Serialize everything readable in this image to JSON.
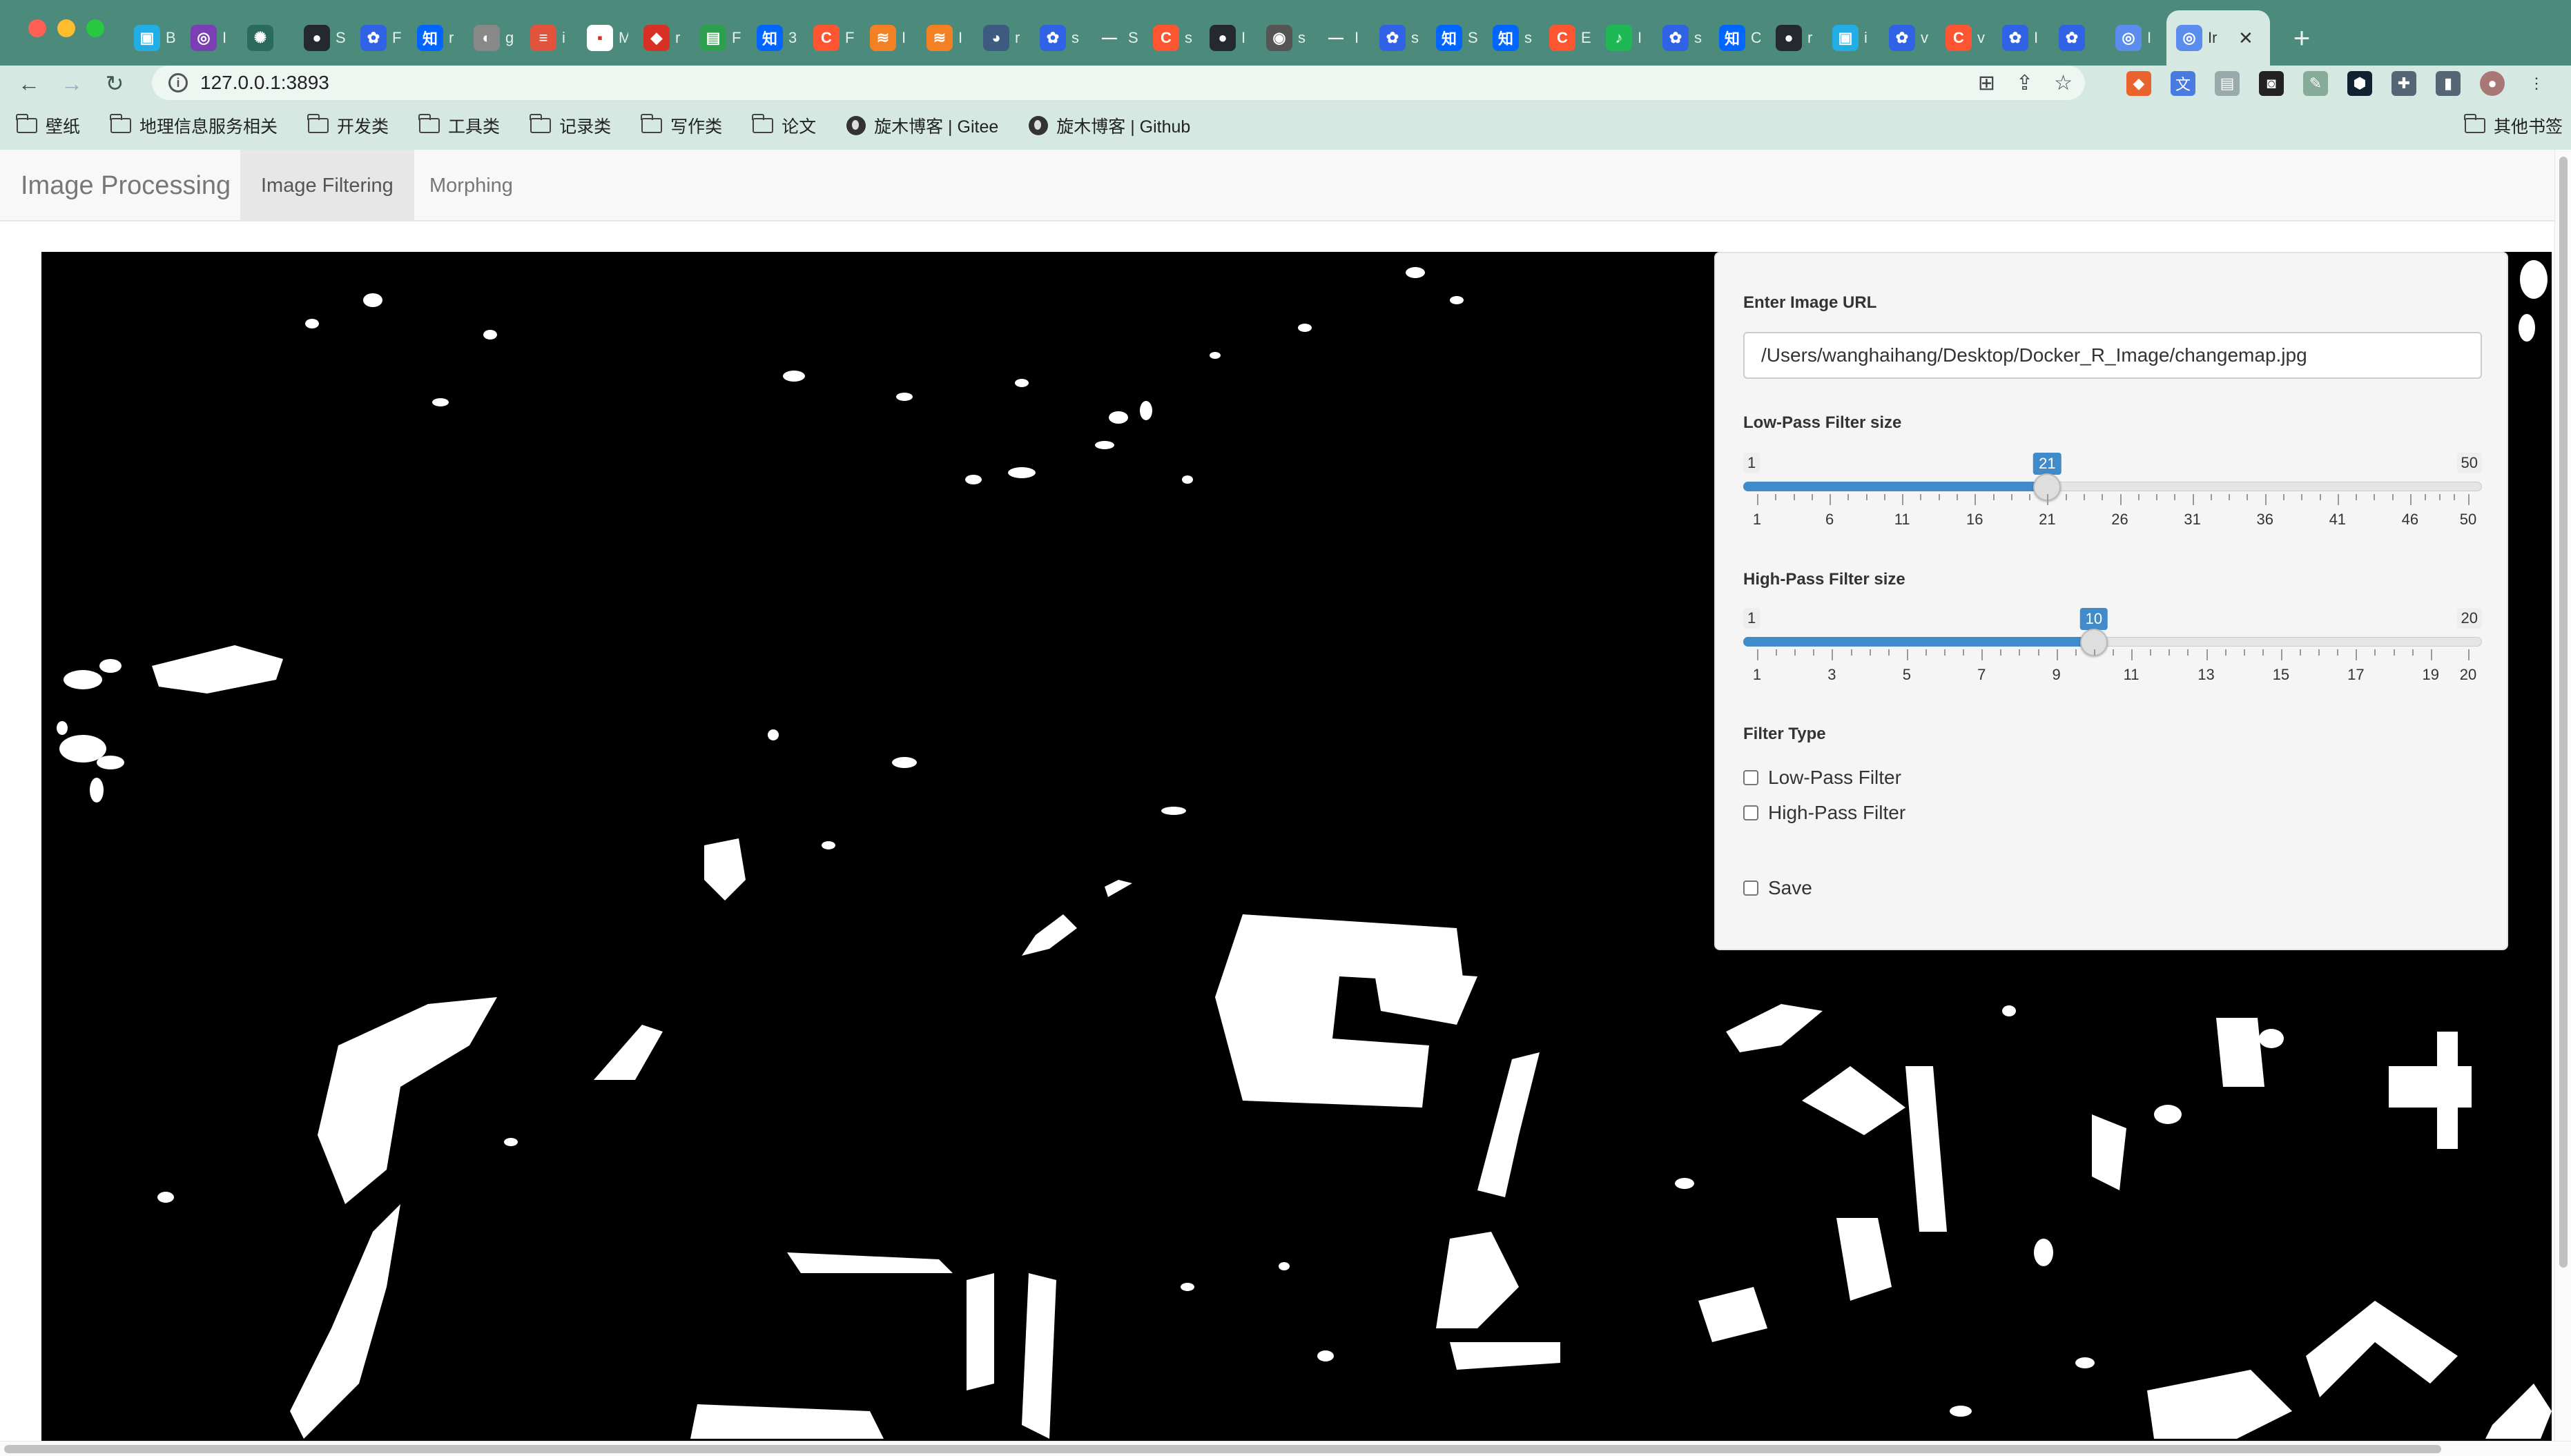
{
  "browser": {
    "url": "127.0.0.1:3893",
    "tabs": [
      {
        "icon": "bilibili-icon",
        "color": "#23ade5",
        "glyph": "▣",
        "label": "B"
      },
      {
        "icon": "app-icon",
        "color": "#7a3fb3",
        "glyph": "◎",
        "label": "I"
      },
      {
        "icon": "openai-icon",
        "color": "#2b6b5f",
        "glyph": "✺",
        "label": ""
      },
      {
        "icon": "github-icon",
        "color": "#24292f",
        "glyph": "●",
        "label": "S"
      },
      {
        "icon": "baidu-icon",
        "color": "#2f62e5",
        "glyph": "✿",
        "label": "F"
      },
      {
        "icon": "zhihu-icon",
        "color": "#0066ff",
        "glyph": "知",
        "label": "r"
      },
      {
        "icon": "generic-icon",
        "color": "#888888",
        "glyph": "◐",
        "label": "g"
      },
      {
        "icon": "docs-icon",
        "color": "#e2533d",
        "glyph": "≡",
        "label": "i"
      },
      {
        "icon": "page-icon",
        "color": "#ffffff",
        "glyph": "▪",
        "label": "M"
      },
      {
        "icon": "app-icon",
        "color": "#d93025",
        "glyph": "◆",
        "label": "r"
      },
      {
        "icon": "green-icon",
        "color": "#2e9e4f",
        "glyph": "▤",
        "label": "F"
      },
      {
        "icon": "zhihu-icon",
        "color": "#0066ff",
        "glyph": "知",
        "label": "3"
      },
      {
        "icon": "csdn-icon",
        "color": "#fc5531",
        "glyph": "C",
        "label": "F"
      },
      {
        "icon": "stackoverflow-icon",
        "color": "#f48024",
        "glyph": "≋",
        "label": "I"
      },
      {
        "icon": "stackoverflow-icon",
        "color": "#f48024",
        "glyph": "≋",
        "label": "I"
      },
      {
        "icon": "generic-icon",
        "color": "#3d5a80",
        "glyph": "◕",
        "label": "r"
      },
      {
        "icon": "baidu-icon",
        "color": "#2f62e5",
        "glyph": "✿",
        "label": "s"
      },
      {
        "icon": "generic-icon",
        "color": "#4c8a7c",
        "glyph": "—",
        "label": "S"
      },
      {
        "icon": "csdn-icon",
        "color": "#fc5531",
        "glyph": "C",
        "label": "s"
      },
      {
        "icon": "github-icon",
        "color": "#24292f",
        "glyph": "●",
        "label": "I"
      },
      {
        "icon": "generic-icon",
        "color": "#555555",
        "glyph": "◉",
        "label": "s"
      },
      {
        "icon": "generic-icon",
        "color": "#4c8a7c",
        "glyph": "—",
        "label": "I"
      },
      {
        "icon": "baidu-icon",
        "color": "#2f62e5",
        "glyph": "✿",
        "label": "s"
      },
      {
        "icon": "zhihu-icon",
        "color": "#0066ff",
        "glyph": "知",
        "label": "S"
      },
      {
        "icon": "zhihu-icon",
        "color": "#0066ff",
        "glyph": "知",
        "label": "s"
      },
      {
        "icon": "csdn-icon",
        "color": "#fc5531",
        "glyph": "C",
        "label": "E"
      },
      {
        "icon": "music-icon",
        "color": "#1db954",
        "glyph": "♪",
        "label": "I"
      },
      {
        "icon": "baidu-icon",
        "color": "#2f62e5",
        "glyph": "✿",
        "label": "s"
      },
      {
        "icon": "zhihu-icon",
        "color": "#0066ff",
        "glyph": "知",
        "label": "C"
      },
      {
        "icon": "github-icon",
        "color": "#24292f",
        "glyph": "●",
        "label": "r"
      },
      {
        "icon": "bilibili-icon",
        "color": "#23ade5",
        "glyph": "▣",
        "label": "i"
      },
      {
        "icon": "baidu-icon",
        "color": "#2f62e5",
        "glyph": "✿",
        "label": "v"
      },
      {
        "icon": "csdn-icon",
        "color": "#fc5531",
        "glyph": "C",
        "label": "v"
      },
      {
        "icon": "baidu-icon",
        "color": "#2f62e5",
        "glyph": "✿",
        "label": "I"
      },
      {
        "icon": "baidu-icon",
        "color": "#2f62e5",
        "glyph": "✿",
        "label": ""
      },
      {
        "icon": "app-icon",
        "color": "#5b8def",
        "glyph": "◎",
        "label": "I"
      }
    ],
    "active_tab_label": "Ir",
    "bookmarks": [
      {
        "icon": "folder-icon",
        "label": "壁纸"
      },
      {
        "icon": "folder-icon",
        "label": "地理信息服务相关"
      },
      {
        "icon": "folder-icon",
        "label": "开发类"
      },
      {
        "icon": "folder-icon",
        "label": "工具类"
      },
      {
        "icon": "folder-icon",
        "label": "记录类"
      },
      {
        "icon": "folder-icon",
        "label": "写作类"
      },
      {
        "icon": "folder-icon",
        "label": "论文"
      },
      {
        "icon": "globe-icon",
        "label": "旋木博客 | Gitee"
      },
      {
        "icon": "globe-icon",
        "label": "旋木博客 | Github"
      }
    ],
    "other_bookmarks": "其他书签"
  },
  "app": {
    "brand": "Image Processing",
    "tabs": [
      {
        "label": "Image Filtering",
        "active": true
      },
      {
        "label": "Morphing",
        "active": false
      }
    ]
  },
  "panel": {
    "url_label": "Enter Image URL",
    "url_value": "/Users/wanghaihang/Desktop/Docker_R_Image/changemap.jpg",
    "lowpass": {
      "label": "Low-Pass Filter size",
      "min": 1,
      "max": 50,
      "value": 21,
      "min_label": "1",
      "max_label": "50",
      "value_label": "21",
      "ticks": [
        "1",
        "6",
        "11",
        "16",
        "21",
        "26",
        "31",
        "36",
        "41",
        "46",
        "50"
      ]
    },
    "highpass": {
      "label": "High-Pass Filter size",
      "min": 1,
      "max": 20,
      "value": 10,
      "min_label": "1",
      "max_label": "20",
      "value_label": "10",
      "ticks": [
        "1",
        "3",
        "5",
        "7",
        "9",
        "11",
        "13",
        "15",
        "17",
        "19",
        "20"
      ]
    },
    "filter_type_label": "Filter Type",
    "options": {
      "lowpass": {
        "label": "Low-Pass Filter",
        "checked": false
      },
      "highpass": {
        "label": "High-Pass Filter",
        "checked": false
      },
      "save": {
        "label": "Save",
        "checked": false
      }
    }
  },
  "colors": {
    "chrome_title": "#4c8a7c",
    "chrome_toolbar": "#d5e9e2",
    "slider_accent": "#428bca",
    "image_background": "#000000",
    "image_foreground": "#ffffff"
  }
}
